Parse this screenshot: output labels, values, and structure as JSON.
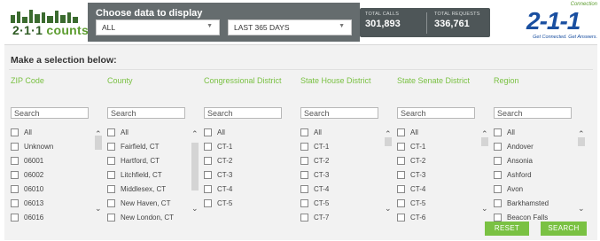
{
  "header": {
    "logo_text_a": "2·1·1",
    "logo_text_b": " counts",
    "chooser_title": "Choose data to display",
    "data_type_select": "ALL",
    "date_range_select": "LAST 365 DAYS",
    "totals": [
      {
        "label": "TOTAL CALLS",
        "value": "301,893"
      },
      {
        "label": "TOTAL REQUESTS",
        "value": "336,761"
      }
    ],
    "brand_top": "Connection",
    "brand_big": "2-1-1",
    "brand_tag": "Get Connected. Get Answers."
  },
  "panel": {
    "heading": "Make a selection below:",
    "search_placeholder": "Search",
    "columns": [
      {
        "title": "ZIP Code",
        "items": [
          "All",
          "Unknown",
          "06001",
          "06002",
          "06010",
          "06013",
          "06016"
        ],
        "scroll_thumb": [
          0.1,
          0.16
        ]
      },
      {
        "title": "County",
        "items": [
          "All",
          "Fairfield, CT",
          "Hartford, CT",
          "Litchfield, CT",
          "Middlesex, CT",
          "New Haven, CT",
          "New London, CT"
        ],
        "scroll_thumb": [
          0.18,
          0.55
        ]
      },
      {
        "title": "Congressional District",
        "items": [
          "All",
          "CT-1",
          "CT-2",
          "CT-3",
          "CT-4",
          "CT-5"
        ],
        "scroll_thumb": null
      },
      {
        "title": "State House District",
        "items": [
          "All",
          "CT-1",
          "CT-2",
          "CT-3",
          "CT-4",
          "CT-5",
          "CT-7"
        ],
        "scroll_thumb": [
          0.12,
          0.1
        ]
      },
      {
        "title": "State Senate District",
        "items": [
          "All",
          "CT-1",
          "CT-2",
          "CT-3",
          "CT-4",
          "CT-5",
          "CT-6"
        ],
        "scroll_thumb": [
          0.12,
          0.1
        ]
      },
      {
        "title": "Region",
        "items": [
          "All",
          "Andover",
          "Ansonia",
          "Ashford",
          "Avon",
          "Barkhamsted",
          "Beacon Falls"
        ],
        "scroll_thumb": [
          0.12,
          0.1
        ]
      }
    ],
    "reset_label": "RESET",
    "search_label": "SEARCH"
  },
  "colors": {
    "accent_green": "#7ac143",
    "header_gray": "#656c6e",
    "brand_blue": "#1a4fa0"
  }
}
